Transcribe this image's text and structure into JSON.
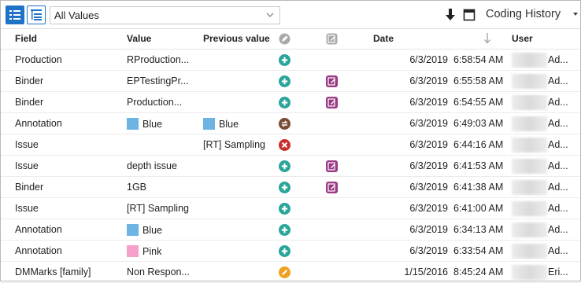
{
  "toolbar": {
    "list_view_icon": "list-view-icon",
    "tree_view_icon": "tree-view-icon",
    "filter_value": "All Values",
    "download_icon": "download-icon",
    "panel_icon": "panel-icon",
    "title": "Coding History"
  },
  "columns": {
    "field": "Field",
    "value": "Value",
    "previous_value": "Previous value",
    "action_icon": "pencil-icon",
    "spc_icon": "edit-icon",
    "date": "Date",
    "sort_icon": "sort-down-arrow-icon",
    "user": "User"
  },
  "colors": {
    "accent": "#1e73c8",
    "added": "#2aa59a",
    "removed": "#c9302c",
    "replaced": "#7a4a35",
    "edited": "#f0a020",
    "spc": "#9b3a84",
    "blue_swatch": "#6db3e3",
    "pink_swatch": "#f5a0c8"
  },
  "rows": [
    {
      "field": "Production",
      "value": "RProduction...",
      "value_swatch": "",
      "previous": "",
      "previous_swatch": "",
      "action": "added",
      "spc": false,
      "date": "6/3/2019",
      "time": "6:58:54 AM",
      "user_suffix": "Ad..."
    },
    {
      "field": "Binder",
      "value": "EPTestingPr...",
      "value_swatch": "",
      "previous": "",
      "previous_swatch": "",
      "action": "added",
      "spc": true,
      "date": "6/3/2019",
      "time": "6:55:58 AM",
      "user_suffix": "Ad..."
    },
    {
      "field": "Binder",
      "value": "Production...",
      "value_swatch": "",
      "previous": "",
      "previous_swatch": "",
      "action": "added",
      "spc": true,
      "date": "6/3/2019",
      "time": "6:54:55 AM",
      "user_suffix": "Ad..."
    },
    {
      "field": "Annotation",
      "value": "Blue",
      "value_swatch": "#6db3e3",
      "previous": "Blue",
      "previous_swatch": "#6db3e3",
      "action": "replaced",
      "spc": false,
      "date": "6/3/2019",
      "time": "6:49:03 AM",
      "user_suffix": "Ad..."
    },
    {
      "field": "Issue",
      "value": "",
      "value_swatch": "",
      "previous": "[RT] Sampling",
      "previous_swatch": "",
      "action": "removed",
      "spc": false,
      "date": "6/3/2019",
      "time": "6:44:16 AM",
      "user_suffix": "Ad..."
    },
    {
      "field": "Issue",
      "value": "depth issue",
      "value_swatch": "",
      "previous": "",
      "previous_swatch": "",
      "action": "added",
      "spc": true,
      "date": "6/3/2019",
      "time": "6:41:53 AM",
      "user_suffix": "Ad..."
    },
    {
      "field": "Binder",
      "value": "1GB",
      "value_swatch": "",
      "previous": "",
      "previous_swatch": "",
      "action": "added",
      "spc": true,
      "date": "6/3/2019",
      "time": "6:41:38 AM",
      "user_suffix": "Ad..."
    },
    {
      "field": "Issue",
      "value": "[RT] Sampling",
      "value_swatch": "",
      "previous": "",
      "previous_swatch": "",
      "action": "added",
      "spc": false,
      "date": "6/3/2019",
      "time": "6:41:00 AM",
      "user_suffix": "Ad..."
    },
    {
      "field": "Annotation",
      "value": "Blue",
      "value_swatch": "#6db3e3",
      "previous": "",
      "previous_swatch": "",
      "action": "added",
      "spc": false,
      "date": "6/3/2019",
      "time": "6:34:13 AM",
      "user_suffix": "Ad..."
    },
    {
      "field": "Annotation",
      "value": "Pink",
      "value_swatch": "#f5a0c8",
      "previous": "",
      "previous_swatch": "",
      "action": "added",
      "spc": false,
      "date": "6/3/2019",
      "time": "6:33:54 AM",
      "user_suffix": "Ad..."
    },
    {
      "field": "DMMarks [family]",
      "value": "Non Respon...",
      "value_swatch": "",
      "previous": "",
      "previous_swatch": "",
      "action": "edited",
      "spc": false,
      "date": "1/15/2016",
      "time": "8:45:24 AM",
      "user_suffix": "Eri..."
    }
  ]
}
